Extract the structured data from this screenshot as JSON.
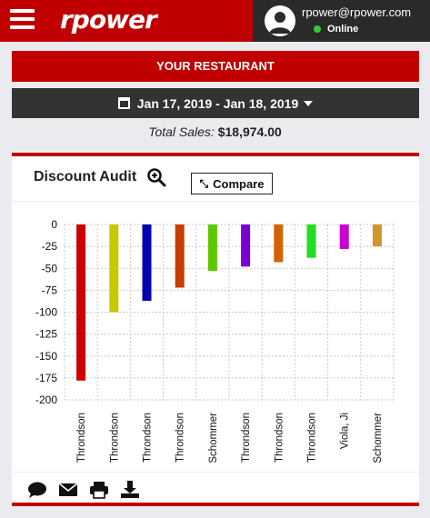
{
  "header": {
    "logo": "rpower",
    "user_email": "rpower@rpower.com",
    "user_status": "Online",
    "brand_color": "#c00000"
  },
  "restaurant": {
    "label": "YOUR RESTAURANT"
  },
  "date_range": {
    "label": "Jan 17, 2019 - Jan 18, 2019"
  },
  "totals": {
    "label": "Total Sales:",
    "value": "$18,974.00"
  },
  "card": {
    "title": "Discount Audit",
    "compare_label": "Compare",
    "footer_icons": [
      "comment-icon",
      "envelope-icon",
      "print-icon",
      "download-icon"
    ]
  },
  "chart_data": {
    "type": "bar",
    "title": "Discount Audit",
    "categories": [
      "Throndson",
      "Throndson",
      "Throndson",
      "Throndson",
      "Schommer",
      "Throndson",
      "Throndson",
      "Throndson",
      "Viola, Ji",
      "Schommer"
    ],
    "values": [
      -178,
      -100,
      -87,
      -72,
      -53,
      -48,
      -43,
      -38,
      -28,
      -25
    ],
    "colors": [
      "#cc0000",
      "#c8c800",
      "#0000b0",
      "#c83c00",
      "#5cc800",
      "#7a00d0",
      "#d26400",
      "#22dd22",
      "#cc00cc",
      "#d2962a"
    ],
    "yticks": [
      0,
      -25,
      -50,
      -75,
      -100,
      -125,
      -150,
      -175,
      -200
    ],
    "ylim": [
      -200,
      0
    ],
    "grid": true
  }
}
